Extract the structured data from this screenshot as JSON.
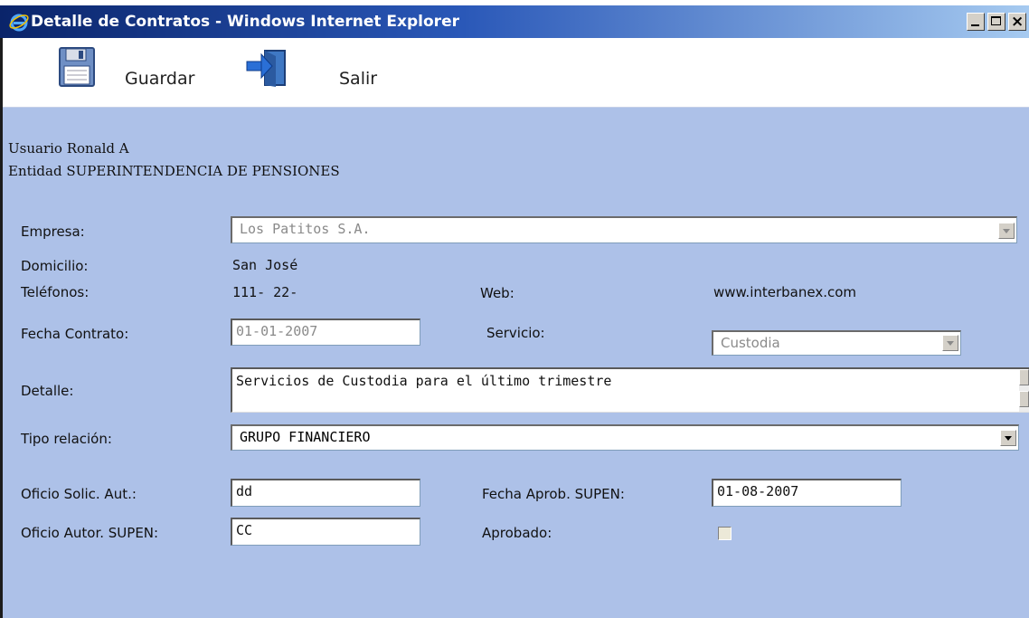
{
  "window": {
    "title": "Detalle de Contratos - Windows Internet Explorer"
  },
  "toolbar": {
    "save_label": "Guardar",
    "exit_label": "Salir"
  },
  "session": {
    "user_line": "Usuario Ronald A",
    "entity_line": "Entidad SUPERINTENDENCIA DE PENSIONES"
  },
  "form": {
    "empresa_label": "Empresa:",
    "empresa_value": "Los Patitos S.A.",
    "domicilio_label": "Domicilio:",
    "domicilio_value": "San José",
    "telefonos_label": "Teléfonos:",
    "telefonos_value": "111- 22-",
    "web_label": "Web:",
    "web_value": "www.interbanex.com",
    "fecha_contrato_label": "Fecha Contrato:",
    "fecha_contrato_value": "01-01-2007",
    "servicio_label": "Servicio:",
    "servicio_value": "Custodia",
    "detalle_label": "Detalle:",
    "detalle_value": "Servicios de Custodia para el último trimestre",
    "tipo_relacion_label": "Tipo relación:",
    "tipo_relacion_value": "GRUPO FINANCIERO",
    "oficio_solic_label": "Oficio Solic. Aut.:",
    "oficio_solic_value": "dd",
    "fecha_aprob_label": "Fecha Aprob. SUPEN:",
    "fecha_aprob_value": "01-08-2007",
    "oficio_autor_label": "Oficio Autor. SUPEN:",
    "oficio_autor_value": "CC",
    "aprobado_label": "Aprobado:",
    "aprobado_checked": false
  },
  "icons": {
    "app": "ie-icon",
    "save": "floppy-disk-icon",
    "exit": "exit-door-icon"
  },
  "colors": {
    "form_background": "#adc1e8",
    "titlebar_start": "#0a246a",
    "titlebar_end": "#a6caf0"
  }
}
